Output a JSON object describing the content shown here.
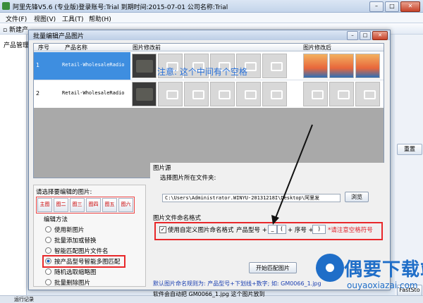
{
  "app": {
    "title": "阿里先锋V5.6 (专业版)登录账号:Trial  到期时间:2015-07-01    公司名称:Trial"
  },
  "menu": [
    "文件(F)",
    "视图(V)",
    "工具(T)",
    "帮助(H)"
  ],
  "toolbar": {
    "new_label": "新建产"
  },
  "left_panel": {
    "label": "产品管理"
  },
  "right_buttons": [
    "重置",
    "FastSto"
  ],
  "status_bar": {
    "label": "运行记录"
  },
  "dialog": {
    "title": "批量编辑产品图片",
    "grid": {
      "headers": [
        "序号",
        "产品名称",
        "图片修改前",
        "图片修改后"
      ],
      "rows": [
        {
          "num": "1",
          "name": "Retail-WholesaleRadio"
        },
        {
          "num": "2",
          "name": "Retail-WholesaleRadio"
        }
      ]
    },
    "select": {
      "title": "请选择要编辑的图片:",
      "image_buttons": [
        "主图",
        "图二",
        "图三",
        "图四",
        "图五",
        "图六"
      ],
      "method_label": "编辑方法",
      "methods": [
        "使用新图片",
        "批量添加或替换",
        "智能匹配图片文件名",
        "按产品型号智能多图匹配",
        "随机选取缩略图",
        "批量删除图片"
      ],
      "selected_index": 3
    },
    "source": {
      "section_title": "图片源",
      "folder_label": "选择图片所在文件夹:",
      "path": "C:\\Users\\Administrator.WINYU-20131218I\\Desktop\\阿里发",
      "browse": "浏览",
      "note": "注意: 这个中间有个空格",
      "naming_title": "图片文件命名格式",
      "custom_label": "使用自定义图片命名格式",
      "model_label": "产品型号 +",
      "sep_value": "_",
      "paren_value": "(",
      "seq_label": "+ 序号 +",
      "close_value": ")",
      "warning": "*请注意空格符号",
      "match_button": "开始匹配图片",
      "default_text": "默认图片命名规则为: 产品型号+下划线+数字; 如: GM0066_1.jpg",
      "auto_text": "软件会自动把 GM0066_1.jpg 这个图片放到"
    }
  },
  "watermark": {
    "title": "偶要下载站",
    "url": "ouyaoxiazai.com"
  }
}
